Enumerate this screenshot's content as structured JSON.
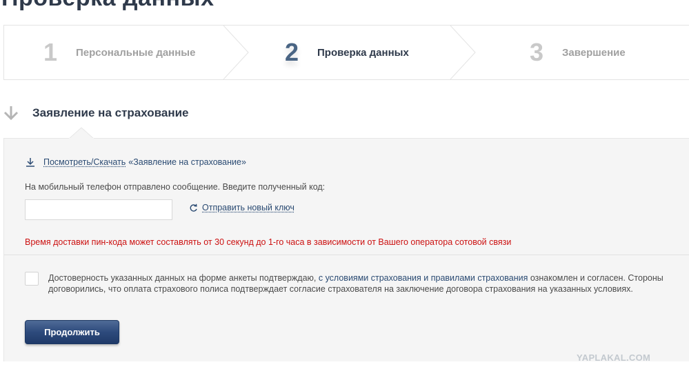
{
  "page": {
    "title": "Проверка данных"
  },
  "steps": [
    {
      "number": "1",
      "label": "Персональные данные"
    },
    {
      "number": "2",
      "label": "Проверка данных"
    },
    {
      "number": "3",
      "label": "Завершение"
    }
  ],
  "section": {
    "title": "Заявление на страхование"
  },
  "form": {
    "download_link": "Посмотреть/Скачать",
    "document_name": "«Заявление на страхование»",
    "sms_prompt": "На мобильный телефон отправлено сообщение. Введите полученный код:",
    "code_value": "",
    "resend_link": "Отправить новый ключ",
    "warning": "Время доставки пин-кода может составлять от 30 секунд до 1-го часа в зависимости от Вашего оператора сотовой связи",
    "agreement": {
      "part1": "Достоверность указанных данных на форме анкеты подтверждаю, ",
      "part2": "с условиями страхования и правилами страхования",
      "part3": " ознакомлен и согласен. Стороны договорились, что оплата страхового полиса подтверждает согласие страхователя на заключение договора страхования на указанных условиях."
    },
    "checked": false,
    "continue_button": "Продолжить"
  },
  "watermark": "YAPLAKAL.COM",
  "colors": {
    "accent": "#2a4a72",
    "warning": "#cc1010",
    "button": "#2d4a7c"
  }
}
